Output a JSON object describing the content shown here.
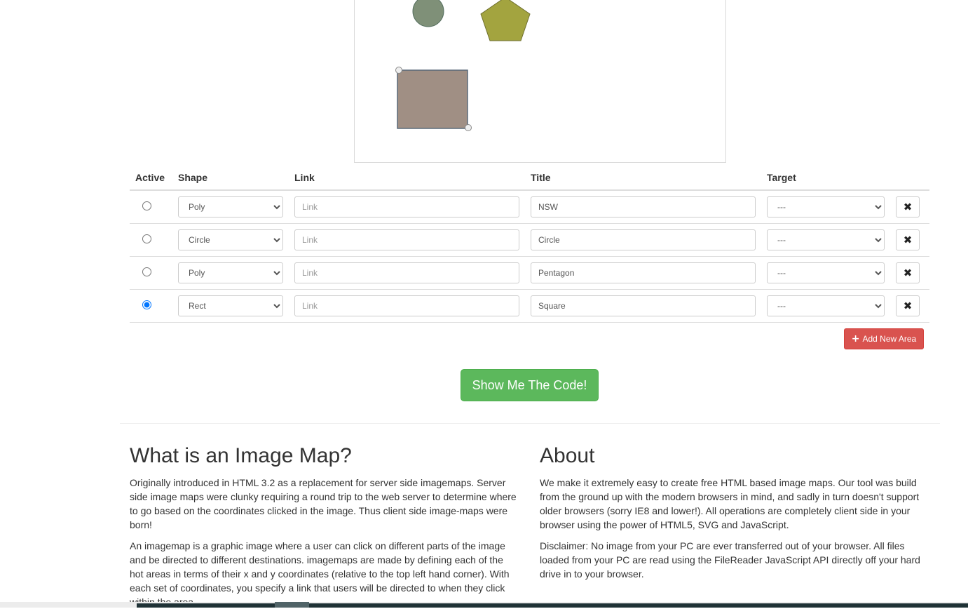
{
  "table": {
    "headers": {
      "active": "Active",
      "shape": "Shape",
      "link": "Link",
      "title": "Title",
      "target": "Target"
    },
    "rows": [
      {
        "active": false,
        "shape": "Poly",
        "link": "",
        "link_placeholder": "Link",
        "title": "NSW",
        "target": "---"
      },
      {
        "active": false,
        "shape": "Circle",
        "link": "",
        "link_placeholder": "Link",
        "title": "Circle",
        "target": "---"
      },
      {
        "active": false,
        "shape": "Poly",
        "link": "",
        "link_placeholder": "Link",
        "title": "Pentagon",
        "target": "---"
      },
      {
        "active": true,
        "shape": "Rect",
        "link": "",
        "link_placeholder": "Link",
        "title": "Square",
        "target": "---"
      }
    ],
    "delete_icon": "times-icon"
  },
  "shape_options": [
    "Rect",
    "Circle",
    "Poly"
  ],
  "target_options": [
    "---"
  ],
  "buttons": {
    "add_area": "Add New Area",
    "show_code": "Show Me The Code!"
  },
  "colors": {
    "danger": "#d9534f",
    "success": "#5cb85c",
    "circle_fill": "#7f9078",
    "pentagon_fill": "#a3a43f",
    "rect_fill": "#a08f84"
  },
  "info": {
    "left": {
      "heading": "What is an Image Map?",
      "p1": "Originally introduced in HTML 3.2 as a replacement for server side imagemaps. Server side image maps were clunky requiring a round trip to the web server to determine where to go based on the coordinates clicked in the image. Thus client side image-maps were born!",
      "p2": "An imagemap is a graphic image where a user can click on different parts of the image and be directed to different destinations. imagemaps are made by defining each of the hot areas in terms of their x and y coordinates (relative to the top left hand corner). With each set of coordinates, you specify a link that users will be directed to when they click within the area."
    },
    "right": {
      "heading": "About",
      "p1": "We make it extremely easy to create free HTML based image maps. Our tool was build from the ground up with the modern browsers in mind, and sadly in turn doesn't support older browsers (sorry IE8 and lower!). All operations are completely client side in your browser using the power of HTML5, SVG and JavaScript.",
      "p2": "Disclaimer: No image from your PC are ever transferred out of your browser. All files loaded from your PC are read using the FileReader JavaScript API directly off your hard drive in to your browser."
    }
  }
}
